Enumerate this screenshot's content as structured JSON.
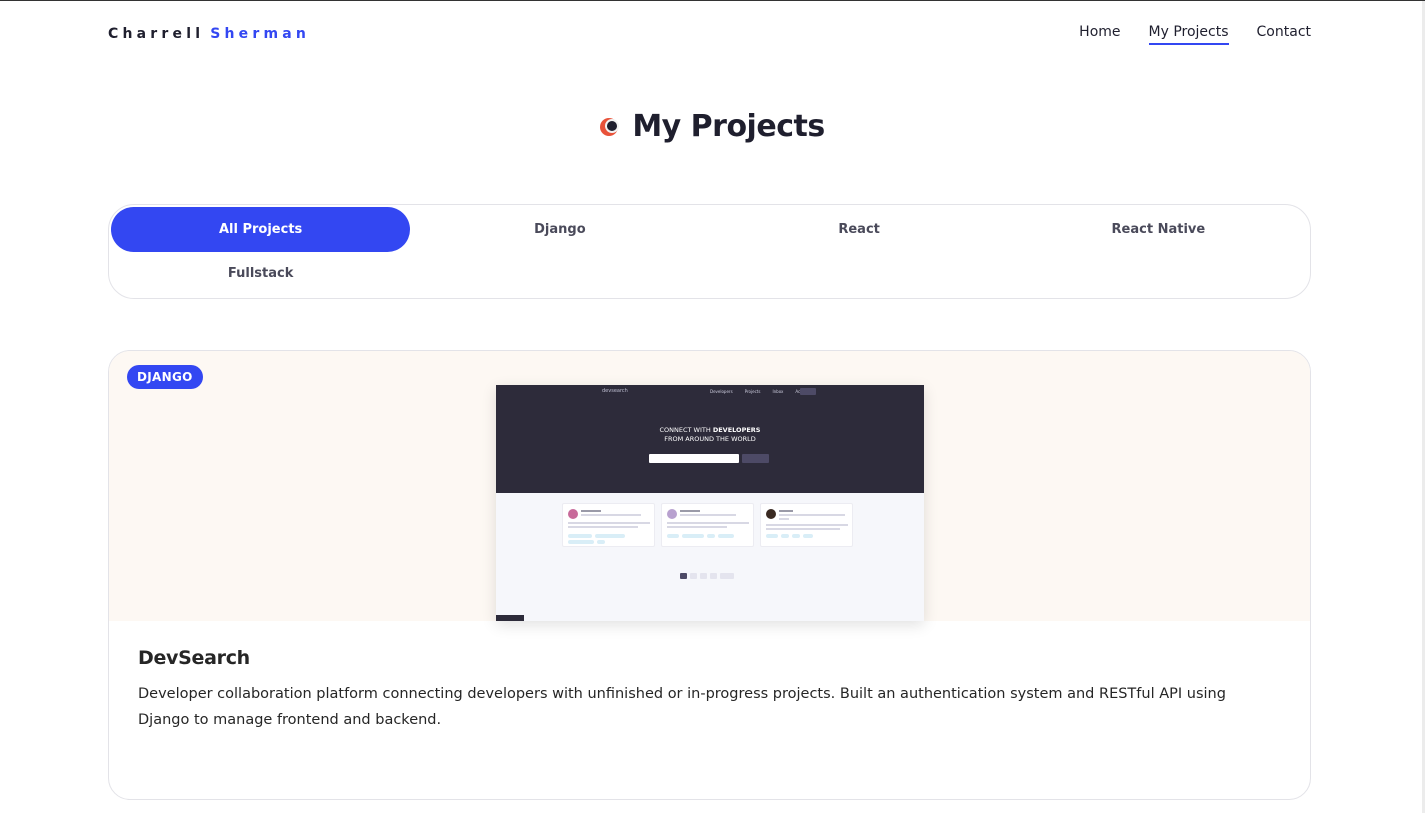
{
  "header": {
    "logo_first": "Charrell",
    "logo_last": "Sherman",
    "nav": [
      {
        "label": "Home"
      },
      {
        "label": "My Projects",
        "active": true
      },
      {
        "label": "Contact"
      }
    ]
  },
  "page": {
    "title": "My Projects"
  },
  "filters": [
    {
      "label": "All Projects",
      "active": true
    },
    {
      "label": "Django"
    },
    {
      "label": "React"
    },
    {
      "label": "React Native"
    },
    {
      "label": "Fullstack"
    }
  ],
  "project": {
    "badge": "DJANGO",
    "title": "DevSearch",
    "description": "Developer collaboration platform connecting developers with unfinished or in-progress projects. Built an authentication system and RESTful API using Django to manage frontend and backend.",
    "screenshot": {
      "headline_line1": "CONNECT WITH",
      "headline_bold": "DEVELOPERS",
      "headline_line2": "FROM AROUND THE WORLD"
    }
  },
  "colors": {
    "accent": "#3347f2",
    "text": "#1f1f2e",
    "card_media_bg": "#fdf8f3",
    "icon_orange": "#e8523a"
  }
}
